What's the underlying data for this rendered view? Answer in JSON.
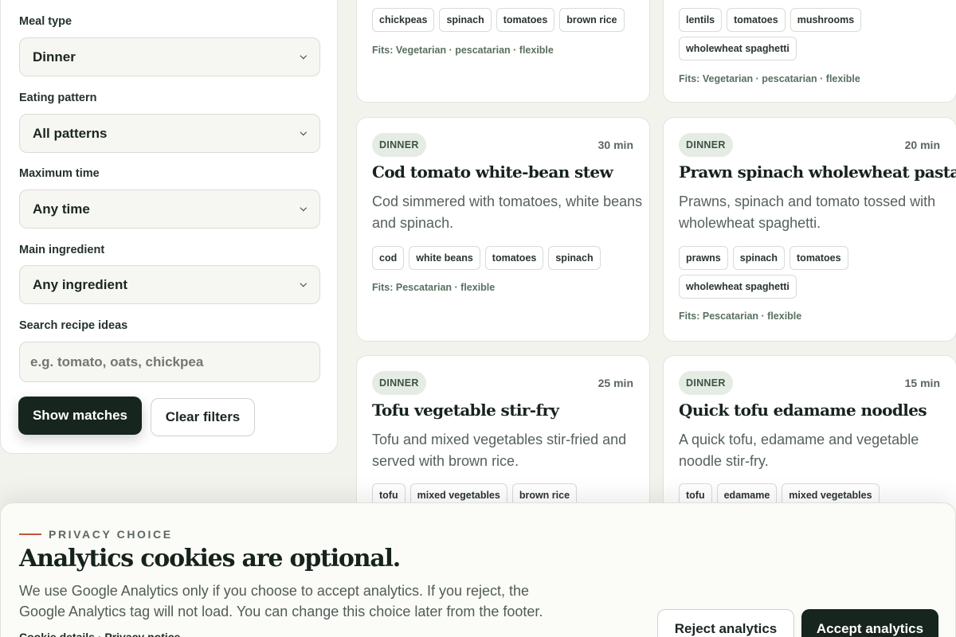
{
  "filters": {
    "meal_type": {
      "label": "Meal type",
      "value": "Dinner"
    },
    "eating_pattern": {
      "label": "Eating pattern",
      "value": "All patterns"
    },
    "max_time": {
      "label": "Maximum time",
      "value": "Any time"
    },
    "main_ingredient": {
      "label": "Main ingredient",
      "value": "Any ingredient"
    },
    "search": {
      "label": "Search recipe ideas",
      "placeholder": "e.g. tomato, oats, chickpea"
    },
    "show_label": "Show matches",
    "clear_label": "Clear filters"
  },
  "cards": [
    {
      "tags": [
        "chickpeas",
        "spinach",
        "tomatoes",
        "brown rice"
      ],
      "fits": "Fits: Vegetarian · pescatarian · flexible"
    },
    {
      "tags": [
        "lentils",
        "tomatoes",
        "mushrooms",
        "wholewheat spaghetti"
      ],
      "fits": "Fits: Vegetarian · pescatarian · flexible"
    },
    {
      "badge": "DINNER",
      "time": "30 min",
      "title": "Cod tomato white-bean stew",
      "desc": "Cod simmered with tomatoes, white beans and spinach.",
      "tags": [
        "cod",
        "white beans",
        "tomatoes",
        "spinach"
      ],
      "fits": "Fits: Pescatarian · flexible"
    },
    {
      "badge": "DINNER",
      "time": "20 min",
      "title": "Prawn spinach wholewheat pasta",
      "desc": "Prawns, spinach and tomato tossed with wholewheat spaghetti.",
      "tags": [
        "prawns",
        "spinach",
        "tomatoes",
        "wholewheat spaghetti"
      ],
      "fits": "Fits: Pescatarian · flexible"
    },
    {
      "badge": "DINNER",
      "time": "25 min",
      "title": "Tofu vegetable stir-fry",
      "desc": "Tofu and mixed vegetables stir-fried and served with brown rice.",
      "tags": [
        "tofu",
        "mixed vegetables",
        "brown rice"
      ]
    },
    {
      "badge": "DINNER",
      "time": "15 min",
      "title": "Quick tofu edamame noodles",
      "desc": "A quick tofu, edamame and vegetable noodle stir-fry.",
      "tags": [
        "tofu",
        "edamame",
        "mixed vegetables"
      ]
    }
  ],
  "cookie": {
    "eyebrow": "PRIVACY CHOICE",
    "title": "Analytics cookies are optional.",
    "text": "We use Google Analytics only if you choose to accept analytics. If you reject, the Google Analytics tag will not load. You can change this choice later from the footer.",
    "link_details": "Cookie details",
    "link_sep": " · ",
    "link_privacy": "Privacy notice",
    "reject_label": "Reject analytics",
    "accept_label": "Accept analytics"
  }
}
